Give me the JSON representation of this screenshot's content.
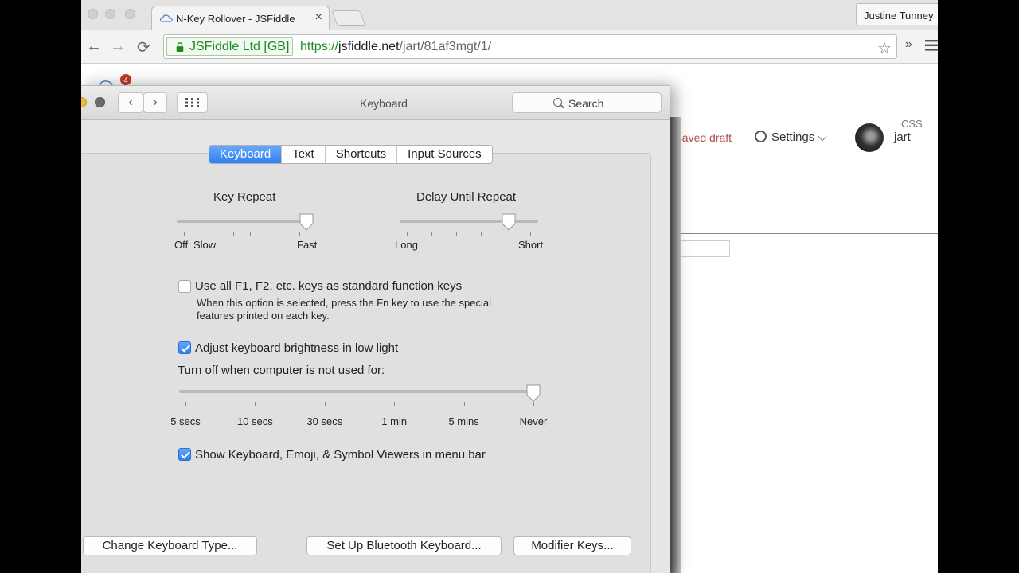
{
  "browser": {
    "tab_title": "N-Key Rollover - JSFiddle",
    "tab_close": "×",
    "profile_name": "Justine Tunney",
    "address": {
      "ev_label": "JSFiddle Ltd [GB]",
      "url_scheme": "https://",
      "url_host": "jsfiddle.net",
      "url_path": "/jart/81af3mgt/1/"
    },
    "nav": {
      "back": "←",
      "forward": "→",
      "reload": "⟳",
      "star": "☆",
      "overflow": "»"
    }
  },
  "jsfiddle": {
    "badge_count": "4",
    "unsaved_label": "nsaved draft",
    "settings_label": "Settings",
    "chevron": "⌵",
    "username": "jart",
    "css_tag": "CSS"
  },
  "prefs": {
    "title": "Keyboard",
    "search_placeholder": "Search",
    "tabs": [
      "Keyboard",
      "Text",
      "Shortcuts",
      "Input Sources"
    ],
    "active_tab": "Keyboard",
    "key_repeat": {
      "title": "Key Repeat",
      "left_label": "Off",
      "mid_label": "Slow",
      "right_label": "Fast",
      "level": 1.0
    },
    "delay_until_repeat": {
      "title": "Delay Until Repeat",
      "left_label": "Long",
      "right_label": "Short",
      "level": 0.78
    },
    "fn_keys": {
      "label": "Use all F1, F2, etc. keys as standard function keys",
      "note_line1": "When this option is selected, press the Fn key to use the special",
      "note_line2": "features printed on each key.",
      "checked": false
    },
    "brightness": {
      "label": "Adjust keyboard brightness in low light",
      "checked": true
    },
    "turn_off": {
      "label": "Turn off when computer is not used for:",
      "ticks": [
        "5 secs",
        "10 secs",
        "30 secs",
        "1 min",
        "5 mins",
        "Never"
      ],
      "selected": "Never"
    },
    "viewers": {
      "label": "Show Keyboard, Emoji, & Symbol Viewers in menu bar",
      "checked": true
    },
    "buttons": {
      "change_type": "Change Keyboard Type...",
      "bluetooth": "Set Up Bluetooth Keyboard...",
      "modifier": "Modifier Keys..."
    },
    "grid_glyph": "⠿",
    "back": "‹",
    "forward": "›"
  },
  "colors": {
    "accent": "#2f7ff3",
    "ev_green": "#1e8a1e",
    "unsaved_red": "#b24c4c"
  }
}
